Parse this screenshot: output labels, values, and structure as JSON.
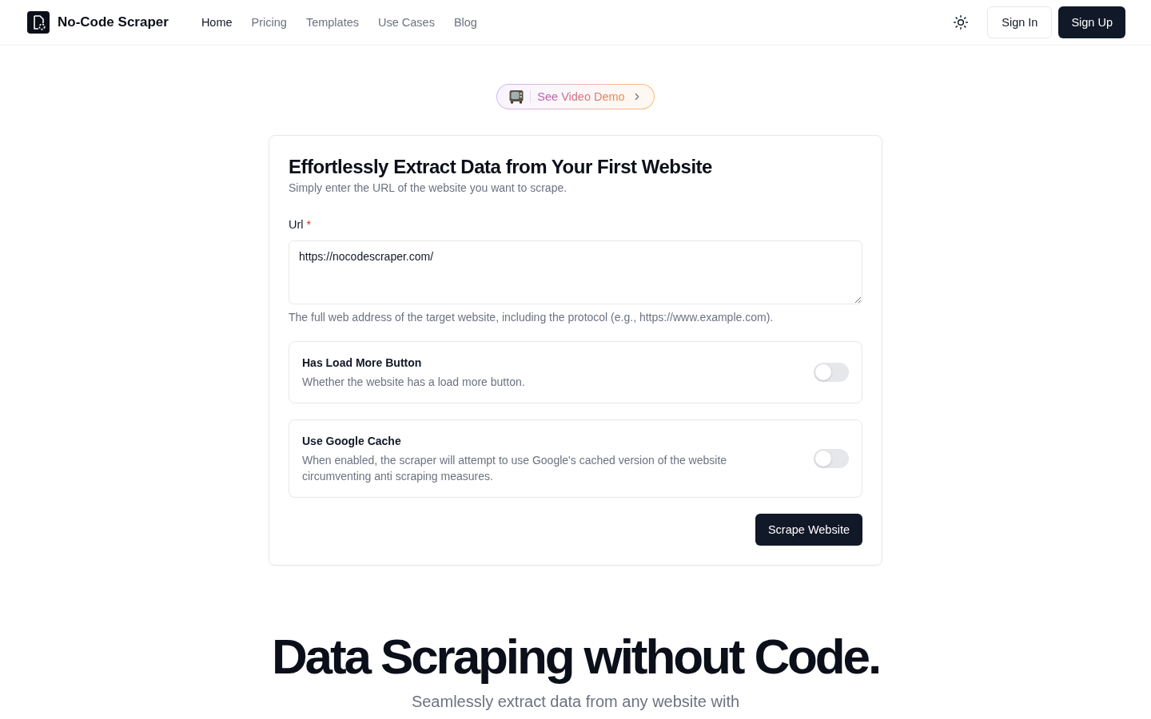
{
  "header": {
    "logo": "No-Code Scraper",
    "nav": [
      {
        "label": "Home",
        "selected": true
      },
      {
        "label": "Pricing",
        "selected": false
      },
      {
        "label": "Templates",
        "selected": false
      },
      {
        "label": "Use Cases",
        "selected": false
      },
      {
        "label": "Blog",
        "selected": false
      }
    ],
    "sign_in": "Sign In",
    "sign_up": "Sign Up"
  },
  "demo_pill": {
    "label": "See Video Demo"
  },
  "form": {
    "title": "Effortlessly Extract Data from Your First Website",
    "subtitle": "Simply enter the URL of the website you want to scrape.",
    "url_label": "Url",
    "required_mark": "*",
    "url_value": "https://nocodescraper.com/",
    "url_help": "The full web address of the target website, including the protocol (e.g., https://www.example.com).",
    "options": [
      {
        "title": "Has Load More Button",
        "description": "Whether the website has a load more button.",
        "on": false
      },
      {
        "title": "Use Google Cache",
        "description": "When enabled, the scraper will attempt to use Google's cached version of the website circumventing anti scraping measures.",
        "on": false
      }
    ],
    "submit": "Scrape Website"
  },
  "hero": {
    "title": "Data Scraping without Code.",
    "subtitle": "Seamlessly extract data from any website with"
  }
}
